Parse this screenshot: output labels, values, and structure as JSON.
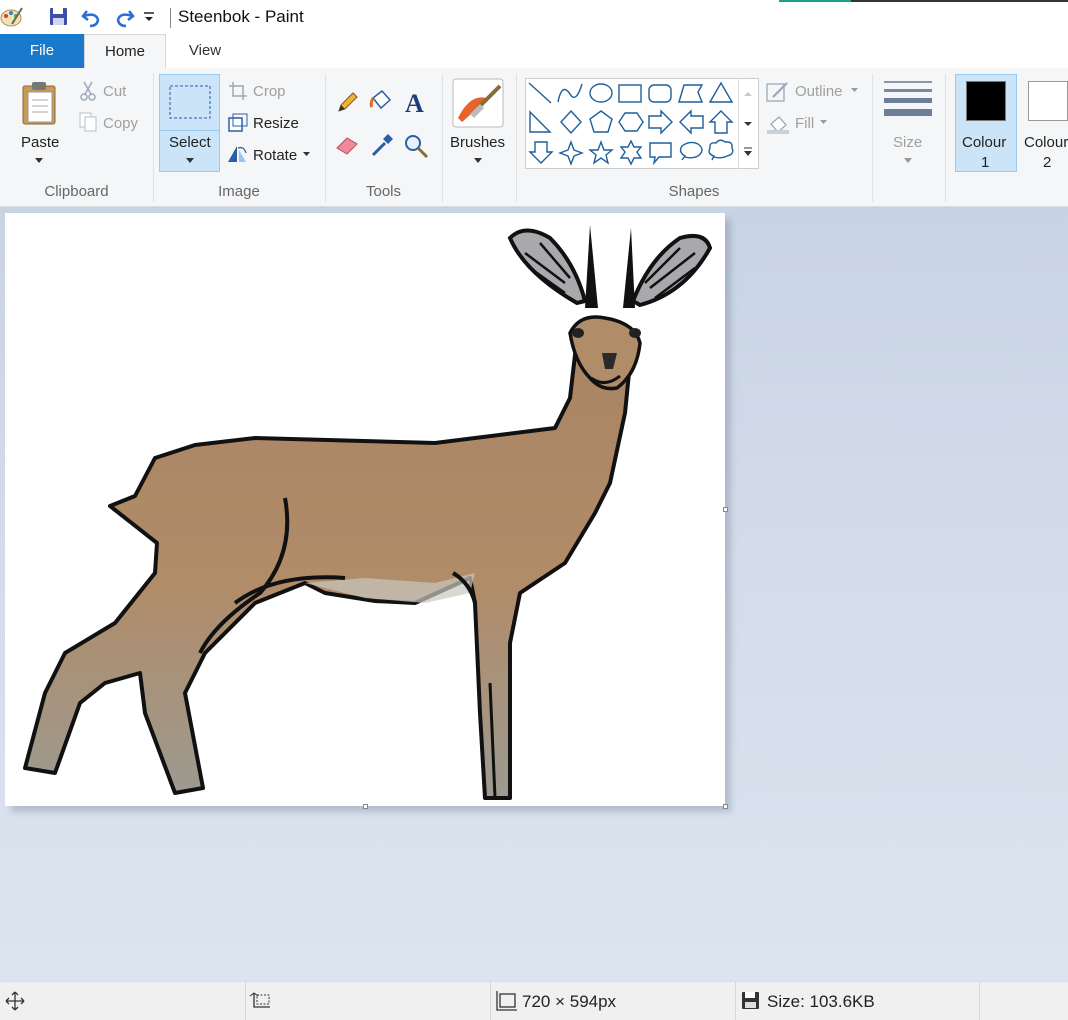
{
  "window": {
    "title": "Steenbok - Paint"
  },
  "tabs": [
    {
      "label": "File"
    },
    {
      "label": "Home"
    },
    {
      "label": "View"
    }
  ],
  "ribbon": {
    "clipboard": {
      "paste": "Paste",
      "cut": "Cut",
      "copy": "Copy",
      "group": "Clipboard"
    },
    "image": {
      "select": "Select",
      "crop": "Crop",
      "resize": "Resize",
      "rotate": "Rotate",
      "group": "Image"
    },
    "tools": {
      "group": "Tools"
    },
    "brushes": {
      "label": "Brushes"
    },
    "shapes": {
      "outline": "Outline",
      "fill": "Fill",
      "group": "Shapes"
    },
    "size": {
      "label": "Size"
    },
    "colours": {
      "colour1_line1": "Colour",
      "colour1_line2": "1",
      "colour2_line1": "Colour",
      "colour2_line2": "2",
      "colour1_value": "#000000",
      "colour2_value": "#ffffff"
    }
  },
  "status": {
    "image_size": "720 × 594px",
    "file_size": "Size: 103.6KB"
  }
}
